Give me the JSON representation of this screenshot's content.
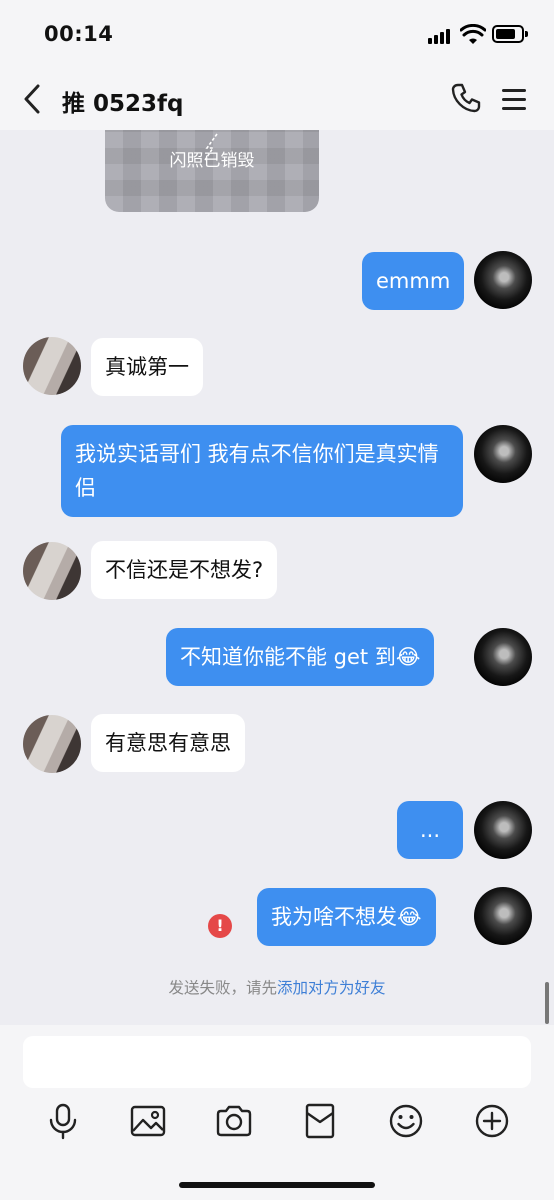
{
  "status_bar": {
    "time": "00:14"
  },
  "nav": {
    "title": "推 0523fq"
  },
  "flash_photo": {
    "label": "闪照已销毁"
  },
  "messages": [
    {
      "from": "me",
      "text": "emmm"
    },
    {
      "from": "other",
      "text": "真诚第一"
    },
    {
      "from": "me",
      "text": "我说实话哥们 我有点不信你们是真实情侣"
    },
    {
      "from": "other",
      "text": "不信还是不想发?"
    },
    {
      "from": "me",
      "text": "不知道你能不能 get 到😂"
    },
    {
      "from": "other",
      "text": "有意思有意思"
    },
    {
      "from": "me",
      "text": "..."
    },
    {
      "from": "me",
      "text": "我为啥不想发😂",
      "status": "failed"
    }
  ],
  "notice": {
    "prefix": "发送失败，请先",
    "link": "添加对方为好友"
  },
  "colors": {
    "accent": "#3e8ff0",
    "error": "#e54848",
    "link": "#3e7fd6"
  },
  "toolbar": [
    "microphone-icon",
    "image-icon",
    "camera-icon",
    "red-packet-icon",
    "emoji-icon",
    "plus-icon"
  ]
}
